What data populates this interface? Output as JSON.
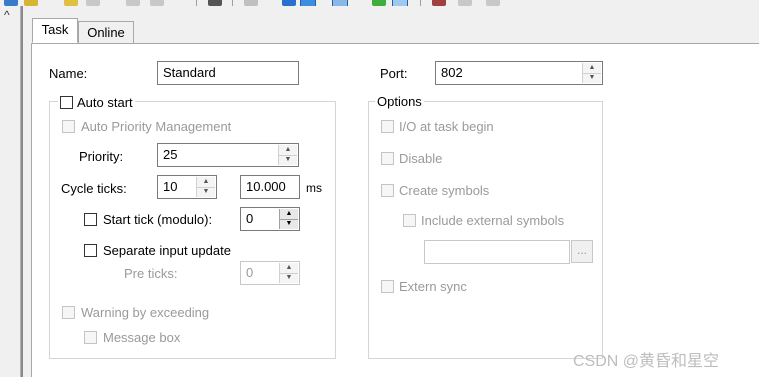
{
  "tabs": [
    {
      "label": "Task",
      "active": true
    },
    {
      "label": "Online",
      "active": false
    }
  ],
  "name_field": {
    "label": "Name:",
    "value": "Standard"
  },
  "port_field": {
    "label": "Port:",
    "value": "802"
  },
  "auto_start": {
    "label": "Auto start",
    "checked": false
  },
  "auto_priority": {
    "label": "Auto Priority Management",
    "checked": false,
    "enabled": false
  },
  "priority": {
    "label": "Priority:",
    "value": "25"
  },
  "cycle_ticks": {
    "label": "Cycle ticks:",
    "value": "10",
    "time_value": "10.000",
    "unit": "ms"
  },
  "start_tick": {
    "label": "Start tick (modulo):",
    "value": "0",
    "checked": false
  },
  "separate_input": {
    "label": "Separate input update",
    "checked": false
  },
  "pre_ticks": {
    "label": "Pre ticks:",
    "value": "0",
    "enabled": false
  },
  "warning": {
    "label": "Warning by exceeding",
    "checked": false,
    "enabled": false
  },
  "message_box": {
    "label": "Message box",
    "checked": false,
    "enabled": false
  },
  "options": {
    "title": "Options",
    "io_at_task_begin": "I/O at task begin",
    "disable": "Disable",
    "create_symbols": "Create symbols",
    "include_external": "Include external symbols",
    "external_path": "",
    "browse_label": "...",
    "extern_sync": "Extern sync"
  },
  "watermark": "CSDN @黄昏和星空",
  "colors": {
    "disabled_text": "#9a9a9a",
    "panel_bg": "#f0f0f0",
    "tab_body_bg": "#ffffff"
  }
}
